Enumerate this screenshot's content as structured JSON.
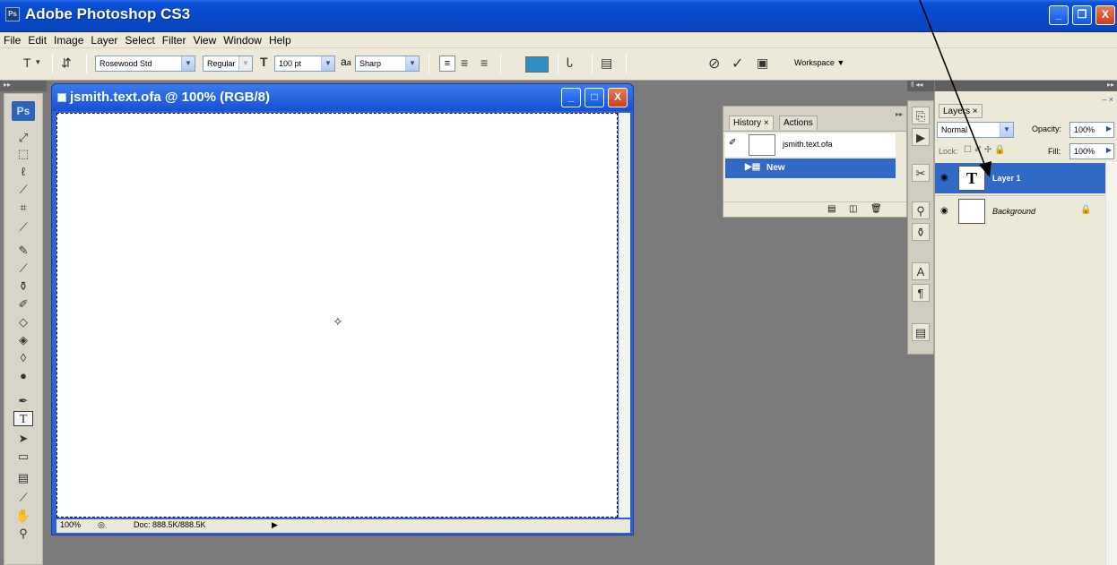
{
  "app": {
    "title": "Adobe Photoshop CS3",
    "icon_label": "Ps"
  },
  "window_buttons": {
    "minimize": "_",
    "maximize": "❐",
    "close": "X"
  },
  "menu": [
    "File",
    "Edit",
    "Image",
    "Layer",
    "Select",
    "Filter",
    "View",
    "Window",
    "Help"
  ],
  "options": {
    "font_family": "Rosewood Std",
    "font_style": "Regular",
    "font_size": "100 pt",
    "aa_prefix": "a",
    "aa_suffix": "a",
    "antialias": "Sharp",
    "workspace": "Workspace ▼",
    "color": "#2f8fc4"
  },
  "document": {
    "title": "jsmith.text.ofa @ 100% (RGB/8)",
    "zoom": "100%",
    "doc_size": "Doc: 888.5K/888.5K"
  },
  "history": {
    "tabs": [
      "History ×",
      "Actions"
    ],
    "snapshot": "jsmith.text.ofa",
    "step": "New"
  },
  "layers": {
    "tab": "Layers ×",
    "blend_mode": "Normal",
    "opacity_label": "Opacity:",
    "opacity": "100%",
    "lock_label": "Lock:",
    "fill_label": "Fill:",
    "fill": "100%",
    "items": [
      {
        "name": "Layer 1",
        "thumb": "T"
      },
      {
        "name": "Background",
        "thumb": ""
      }
    ]
  }
}
